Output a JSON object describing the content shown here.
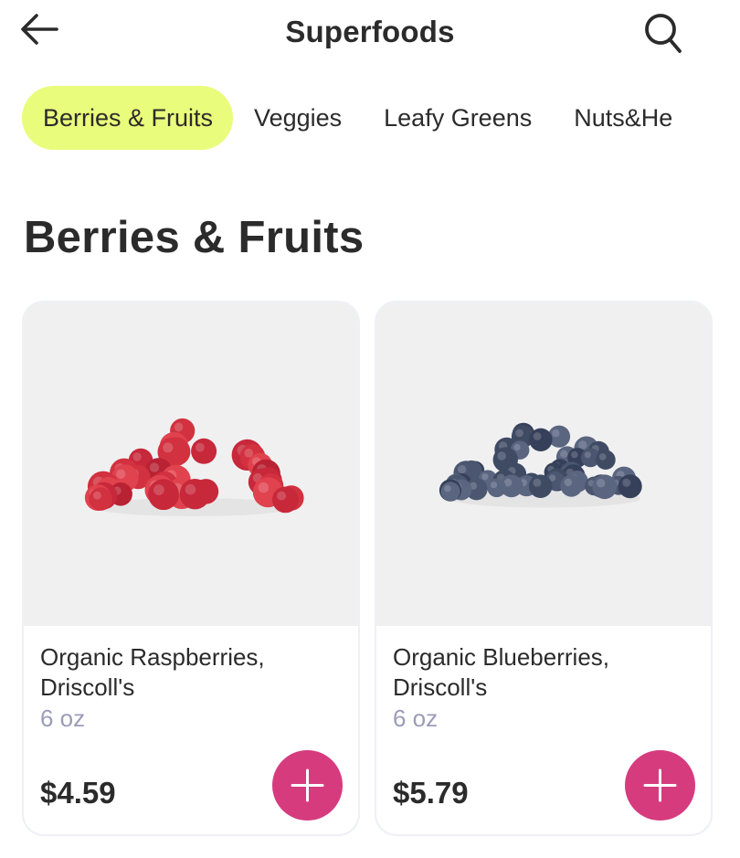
{
  "header": {
    "title": "Superfoods",
    "back_icon": "arrow-left-icon",
    "search_icon": "search-icon"
  },
  "tabs": [
    {
      "label": "Berries & Fruits",
      "active": true
    },
    {
      "label": "Veggies",
      "active": false
    },
    {
      "label": "Leafy Greens",
      "active": false
    },
    {
      "label": "Nuts&He",
      "active": false
    }
  ],
  "section": {
    "title": "Berries & Fruits"
  },
  "products": [
    {
      "name": "Organic Raspberries, Driscoll's",
      "size": "6 oz",
      "price": "$4.59",
      "image": "raspberries-image",
      "add_icon": "plus-icon"
    },
    {
      "name": "Organic Blueberries, Driscoll's",
      "size": "6 oz",
      "price": "$5.79",
      "image": "blueberries-image",
      "add_icon": "plus-icon"
    }
  ],
  "colors": {
    "active_tab": "#eafc7b",
    "add_button": "#d63b7e",
    "size_text": "#9c9cb8",
    "image_bg": "#f0f0f1"
  }
}
